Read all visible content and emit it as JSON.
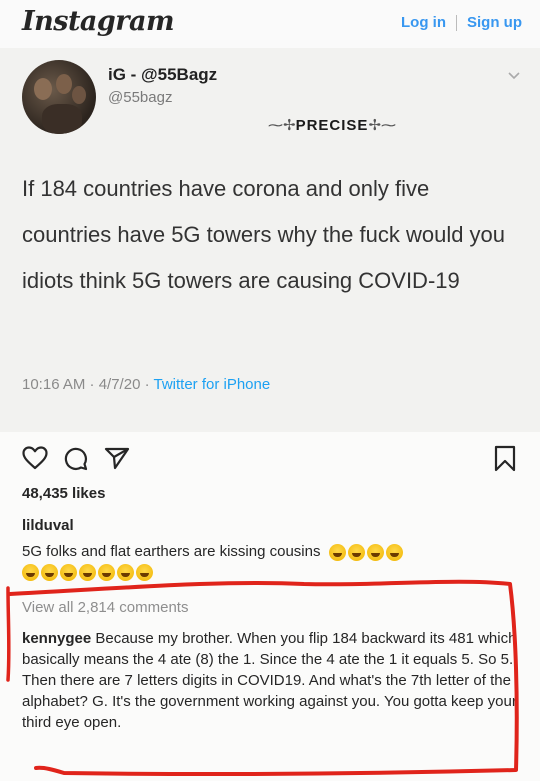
{
  "header": {
    "logo": "Instagram",
    "login": "Log in",
    "signup": "Sign up"
  },
  "tweet": {
    "display_name": "iG - @55Bagz",
    "handle": "@55bagz",
    "watermark": "PRECISE",
    "text": "If 184 countries have corona and only five countries have 5G towers why the fuck would you idiots think 5G towers are causing COVID-19",
    "time": "10:16 AM · 4/7/20 · ",
    "source": "Twitter for iPhone"
  },
  "post": {
    "likes": "48,435 likes",
    "caption_user": "lilduval",
    "caption_text": "5G folks and flat earthers are kissing cousins",
    "view_all": "View all 2,814 comments",
    "comment_user": "kennygee",
    "comment_text": " Because my brother. When you flip 184 backward its 481 which basically means the 4 ate (8) the 1. Since the 4 ate the 1 it equals 5. So 5. Then there are 7 letters digits in COVID19. And what's the 7th letter of the alphabet? G. It's the government working against you. You gotta keep your third eye open."
  },
  "icons": [
    "heart-icon",
    "comment-icon",
    "share-icon",
    "bookmark-icon",
    "chevron-down-icon"
  ],
  "colors": {
    "link": "#3897f0",
    "annotation": "#e0241b"
  }
}
